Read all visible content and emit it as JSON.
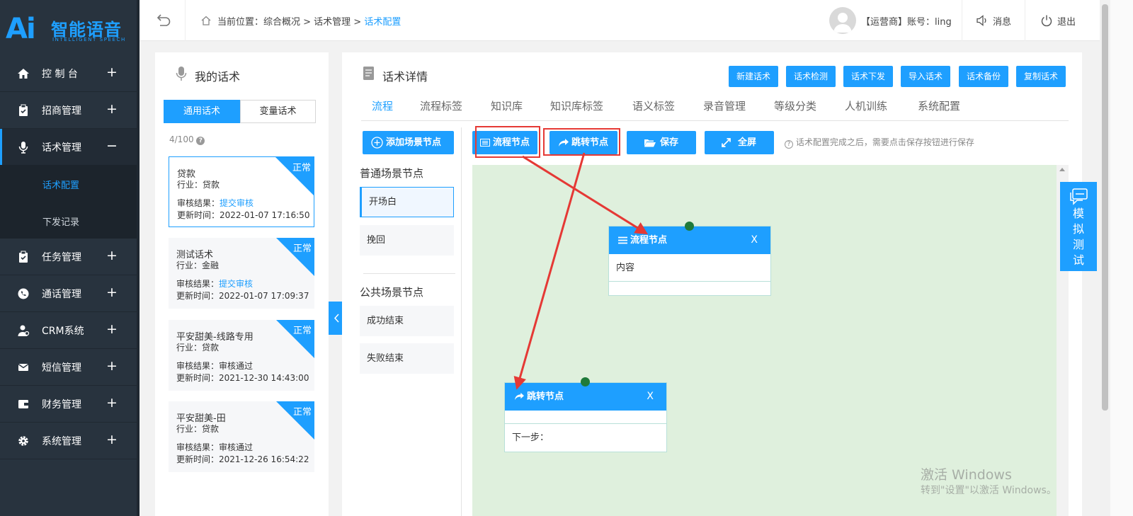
{
  "logo": {
    "ai": "Ai",
    "title": "智能语音",
    "subtitle": "INTELLIGENT SPEECH"
  },
  "sidebar": {
    "items": [
      {
        "label": "控 制 台",
        "toggle": "+",
        "icon": "home-icon"
      },
      {
        "label": "招商管理",
        "toggle": "+",
        "icon": "clipboard-icon"
      },
      {
        "label": "话术管理",
        "toggle": "−",
        "icon": "microphone-icon"
      },
      {
        "label": "任务管理",
        "toggle": "+",
        "icon": "clipboard-icon"
      },
      {
        "label": "通话管理",
        "toggle": "+",
        "icon": "phone-icon"
      },
      {
        "label": "CRM系统",
        "toggle": "+",
        "icon": "user-icon"
      },
      {
        "label": "短信管理",
        "toggle": "+",
        "icon": "mail-icon"
      },
      {
        "label": "财务管理",
        "toggle": "+",
        "icon": "wallet-icon"
      },
      {
        "label": "系统管理",
        "toggle": "+",
        "icon": "gear-icon"
      }
    ],
    "sub_items": [
      {
        "label": "话术配置"
      },
      {
        "label": "下发记录"
      }
    ]
  },
  "header": {
    "breadcrumb_prefix": "当前位置：综合概况 > 话术管理 > ",
    "breadcrumb_current": "话术配置",
    "account": "【运营商】账号：ling",
    "messages": "消息",
    "logout": "退出"
  },
  "left_panel": {
    "title": "我的话术",
    "tabs": [
      "通用话术",
      "变量话术"
    ],
    "count": "4/100",
    "cards": [
      {
        "name": "贷款",
        "industry": "行业：贷款",
        "audit_label": "审核结果：",
        "audit_value": "提交审核",
        "audit_link": true,
        "updated": "更新时间：2022-01-07 17:16:50",
        "status": "正常"
      },
      {
        "name": "测试话术",
        "industry": "行业：金融",
        "audit_label": "审核结果：",
        "audit_value": "提交审核",
        "audit_link": true,
        "updated": "更新时间：2022-01-07 17:09:37",
        "status": "正常"
      },
      {
        "name": "平安甜美-线路专用",
        "industry": "行业：贷款",
        "audit_label": "审核结果：",
        "audit_value": "审核通过",
        "audit_link": false,
        "updated": "更新时间：2021-12-30 14:43:00",
        "status": "正常"
      },
      {
        "name": "平安甜美-田",
        "industry": "行业：贷款",
        "audit_label": "审核结果：",
        "audit_value": "审核通过",
        "audit_link": false,
        "updated": "更新时间：2021-12-26 16:54:22",
        "status": "正常"
      }
    ]
  },
  "main": {
    "title": "话术详情",
    "actions": [
      "新建话术",
      "话术检测",
      "话术下发",
      "导入话术",
      "话术备份",
      "复制话术"
    ],
    "tabs": [
      "流程",
      "流程标签",
      "知识库",
      "知识库标签",
      "语义标签",
      "录音管理",
      "等级分类",
      "人机训练",
      "系统配置"
    ],
    "add_scene": "添加场景节点",
    "normal_scenes_title": "普通场景节点",
    "normal_scenes": [
      "开场白",
      "挽回"
    ],
    "public_scenes_title": "公共场景节点",
    "public_scenes": [
      "成功结束",
      "失败结束"
    ],
    "toolbar": {
      "flow_node": "流程节点",
      "jump_node": "跳转节点",
      "save": "保存",
      "fullscreen": "全屏",
      "hint": "话术配置完成之后，需要点击保存按钮进行保存"
    },
    "canvas": {
      "flow_node": {
        "title": "流程节点",
        "close": "X",
        "content": "内容"
      },
      "jump_node": {
        "title": "跳转节点",
        "close": "X",
        "next": "下一步："
      }
    }
  },
  "simulate": "模拟测试",
  "watermark": {
    "line1": "激活 Windows",
    "line2": "转到\"设置\"以激活 Windows。"
  },
  "colors": {
    "accent": "#1e9fff",
    "sidebar": "#28333e",
    "canvas": "#dff0dd",
    "annotation": "#e53935"
  }
}
